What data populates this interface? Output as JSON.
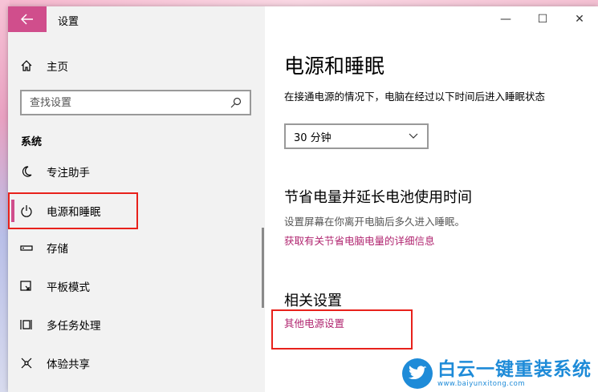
{
  "window": {
    "title": "设置",
    "back_icon": "arrow-left-icon",
    "controls": {
      "minimize": "—",
      "maximize": "☐",
      "close": "✕"
    }
  },
  "sidebar": {
    "home_label": "主页",
    "search_placeholder": "查找设置",
    "section_heading": "系统",
    "items": [
      {
        "label": "专注助手",
        "icon": "moon-icon"
      },
      {
        "label": "电源和睡眠",
        "icon": "power-icon",
        "active": true
      },
      {
        "label": "存储",
        "icon": "storage-icon"
      },
      {
        "label": "平板模式",
        "icon": "tablet-mode-icon"
      },
      {
        "label": "多任务处理",
        "icon": "multitasking-icon"
      },
      {
        "label": "体验共享",
        "icon": "share-icon"
      }
    ]
  },
  "main": {
    "page_title": "电源和睡眠",
    "sleep_desc": "在接通电源的情况下，电脑在经过以下时间后进入睡眠状态",
    "sleep_value": "30 分钟",
    "battery_title": "节省电量并延长电池使用时间",
    "battery_hint": "设置屏幕在你离开电脑后多久进入睡眠。",
    "battery_link": "获取有关节省电脑电量的详细信息",
    "related_title": "相关设置",
    "related_link": "其他电源设置"
  },
  "watermark": {
    "brand": "白云一键重装系统",
    "url": "www.baiyunxitong.com"
  },
  "colors": {
    "accent": "#d04e8c",
    "link": "#b0246f",
    "highlight_box": "#e8211b",
    "watermark": "#1e8bd8"
  }
}
